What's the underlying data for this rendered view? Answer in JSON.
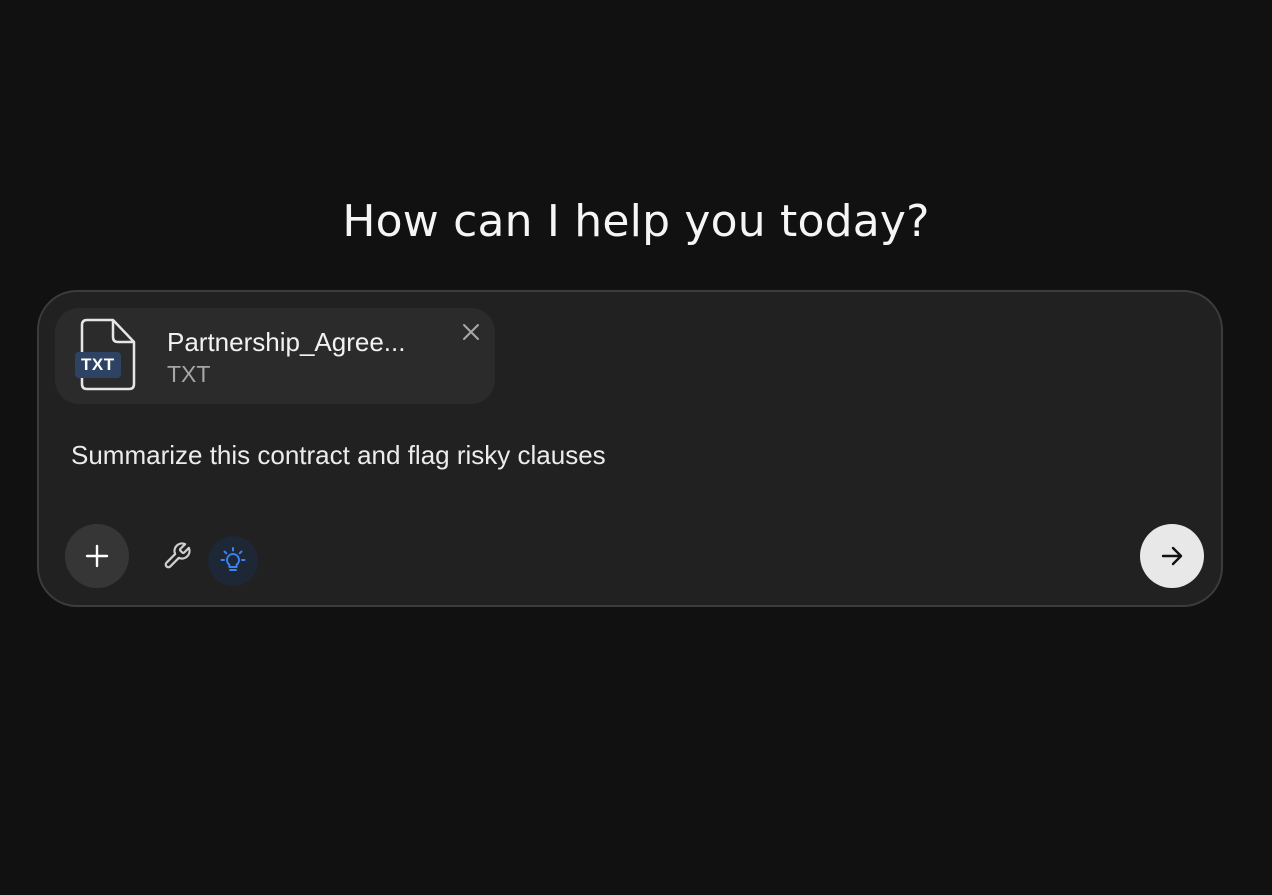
{
  "main": {
    "heading": "How can I help you today?"
  },
  "composer": {
    "attachment": {
      "name": "Partnership_Agree...",
      "type": "TXT",
      "badge": "TXT",
      "icon": "file-icon"
    },
    "prompt_text": "Summarize this contract and flag risky clauses",
    "toolbar": {
      "add_icon": "plus-icon",
      "tools_icon": "wrench-icon",
      "idea_icon": "lightbulb-icon",
      "send_icon": "arrow-right-icon"
    }
  },
  "colors": {
    "background": "#111111",
    "composer_bg": "#212121",
    "accent_blue": "#3b82f6",
    "badge_bg": "#2e4363"
  }
}
